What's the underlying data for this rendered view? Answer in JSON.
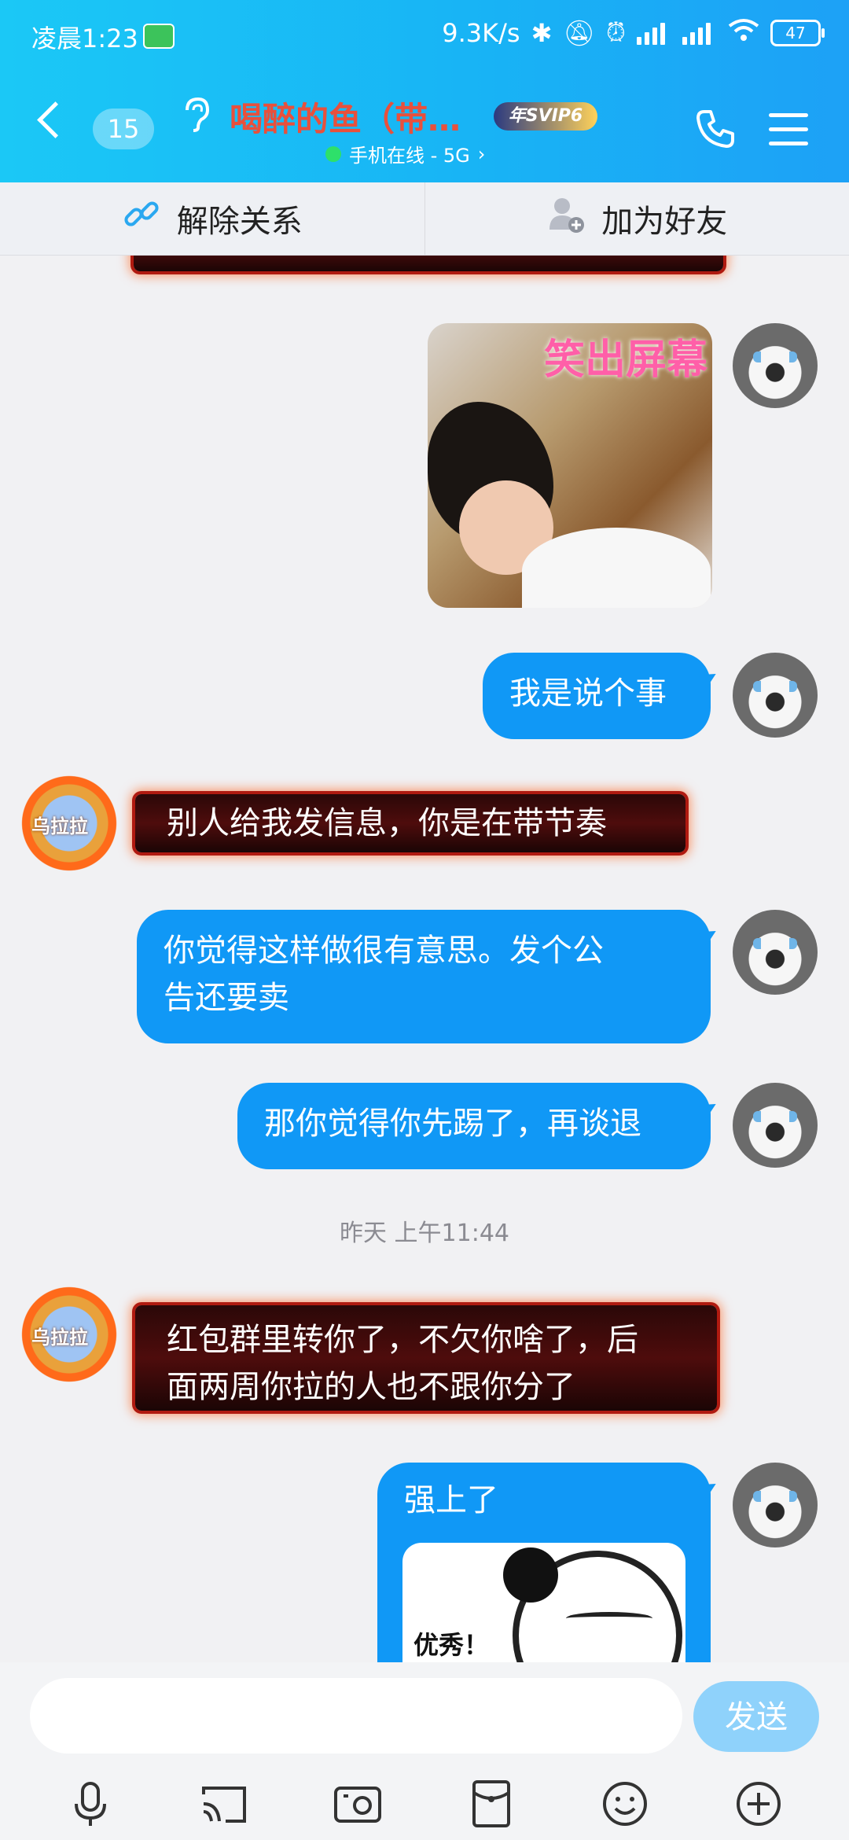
{
  "status_bar": {
    "time": "凌晨1:23",
    "net_speed": "9.3K/s",
    "battery": "47"
  },
  "header": {
    "unread_count": "15",
    "contact_name": "喝醉的鱼（带…",
    "svip_badge": "年SVIP6",
    "online_status": "手机在线 - 5G",
    "brand_colors": {
      "header_start": "#1bc8f6",
      "header_end": "#1da1f6",
      "title": "#e8503c"
    }
  },
  "actions": {
    "remove_relation": "解除关系",
    "add_friend": "加为好友"
  },
  "messages": {
    "image_caption": "笑出屏幕",
    "m1": "我是说个事",
    "m2": "别人给我发信息，你是在带节奏",
    "m3_line1": "你觉得这样做很有意思。发个公",
    "m3_line2": "告还要卖",
    "m4": "那你觉得你先踢了，再谈退",
    "timestamp": "昨天 上午11:44",
    "m5_line1": "红包群里转你了，不欠你啥了，后",
    "m5_line2": "面两周你拉的人也不跟你分了",
    "m6": "强上了",
    "sticker_caption": "优秀！",
    "left_avatar_text": "乌拉拉",
    "bubble_color_self": "#1098f6"
  },
  "composer": {
    "input_value": "",
    "send_label": "发送"
  },
  "toolbar_icons": [
    "microphone-icon",
    "cast-icon",
    "camera-icon",
    "red-packet-icon",
    "emoji-icon",
    "plus-icon"
  ]
}
